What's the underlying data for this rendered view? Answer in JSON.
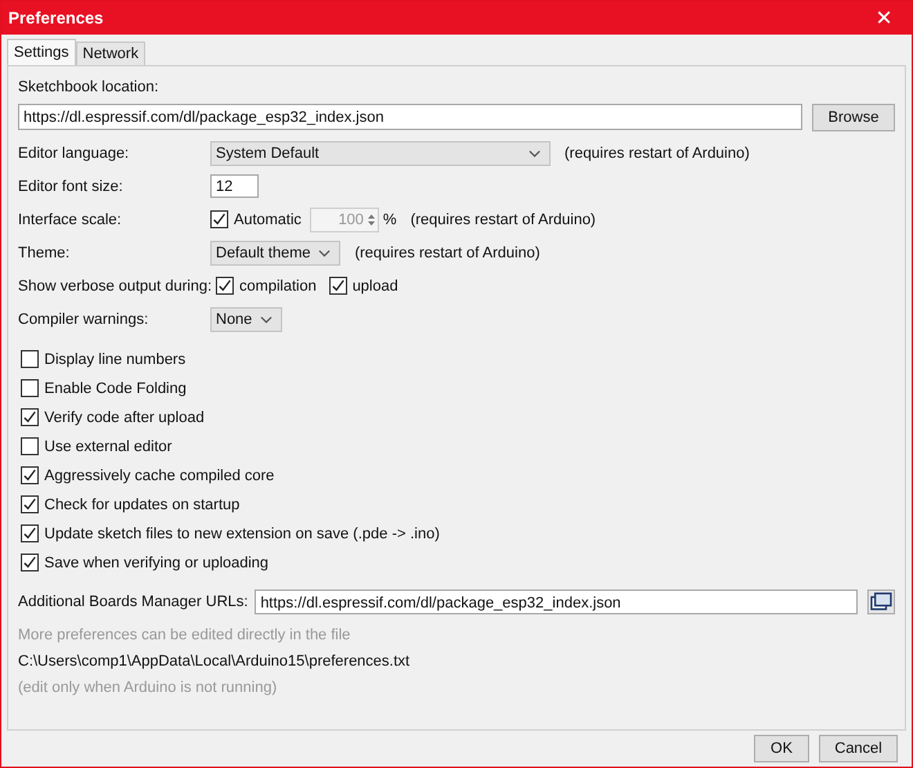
{
  "window": {
    "title": "Preferences",
    "close": "✕"
  },
  "tabs": [
    {
      "label": "Settings",
      "selected": true
    },
    {
      "label": "Network",
      "selected": false
    }
  ],
  "sketchbook": {
    "label": "Sketchbook location:",
    "value": "https://dl.espressif.com/dl/package_esp32_index.json",
    "button": "Browse"
  },
  "editor_language": {
    "label": "Editor language:",
    "value": "System Default",
    "note": "(requires restart of Arduino)"
  },
  "editor_font_size": {
    "label": "Editor font size:",
    "value": "12"
  },
  "interface_scale": {
    "label": "Interface scale:",
    "automatic": {
      "label": "Automatic",
      "checked": true
    },
    "value": "100",
    "unit": "%",
    "note": "(requires restart of Arduino)"
  },
  "theme": {
    "label": "Theme:",
    "value": "Default theme",
    "note": "(requires restart of Arduino)"
  },
  "verbose": {
    "label": "Show verbose output during:",
    "options": [
      {
        "label": "compilation",
        "checked": true
      },
      {
        "label": "upload",
        "checked": true
      }
    ]
  },
  "compiler_warnings": {
    "label": "Compiler warnings:",
    "value": "None"
  },
  "options": [
    {
      "label": "Display line numbers",
      "checked": false
    },
    {
      "label": "Enable Code Folding",
      "checked": false
    },
    {
      "label": "Verify code after upload",
      "checked": true
    },
    {
      "label": "Use external editor",
      "checked": false
    },
    {
      "label": "Aggressively cache compiled core",
      "checked": true
    },
    {
      "label": "Check for updates on startup",
      "checked": true
    },
    {
      "label": "Update sketch files to new extension on save (.pde -> .ino)",
      "checked": true
    },
    {
      "label": "Save when verifying or uploading",
      "checked": true
    }
  ],
  "boards_urls": {
    "label": "Additional Boards Manager URLs:",
    "value": "https://dl.espressif.com/dl/package_esp32_index.json"
  },
  "notes": [
    {
      "text": "More preferences can be edited directly in the file",
      "kind": "hint"
    },
    {
      "text": "C:\\Users\\comp1\\AppData\\Local\\Arduino15\\preferences.txt",
      "kind": "path"
    },
    {
      "text": "(edit only when Arduino is not running)",
      "kind": "hint"
    }
  ],
  "buttons": [
    "OK",
    "Cancel"
  ]
}
